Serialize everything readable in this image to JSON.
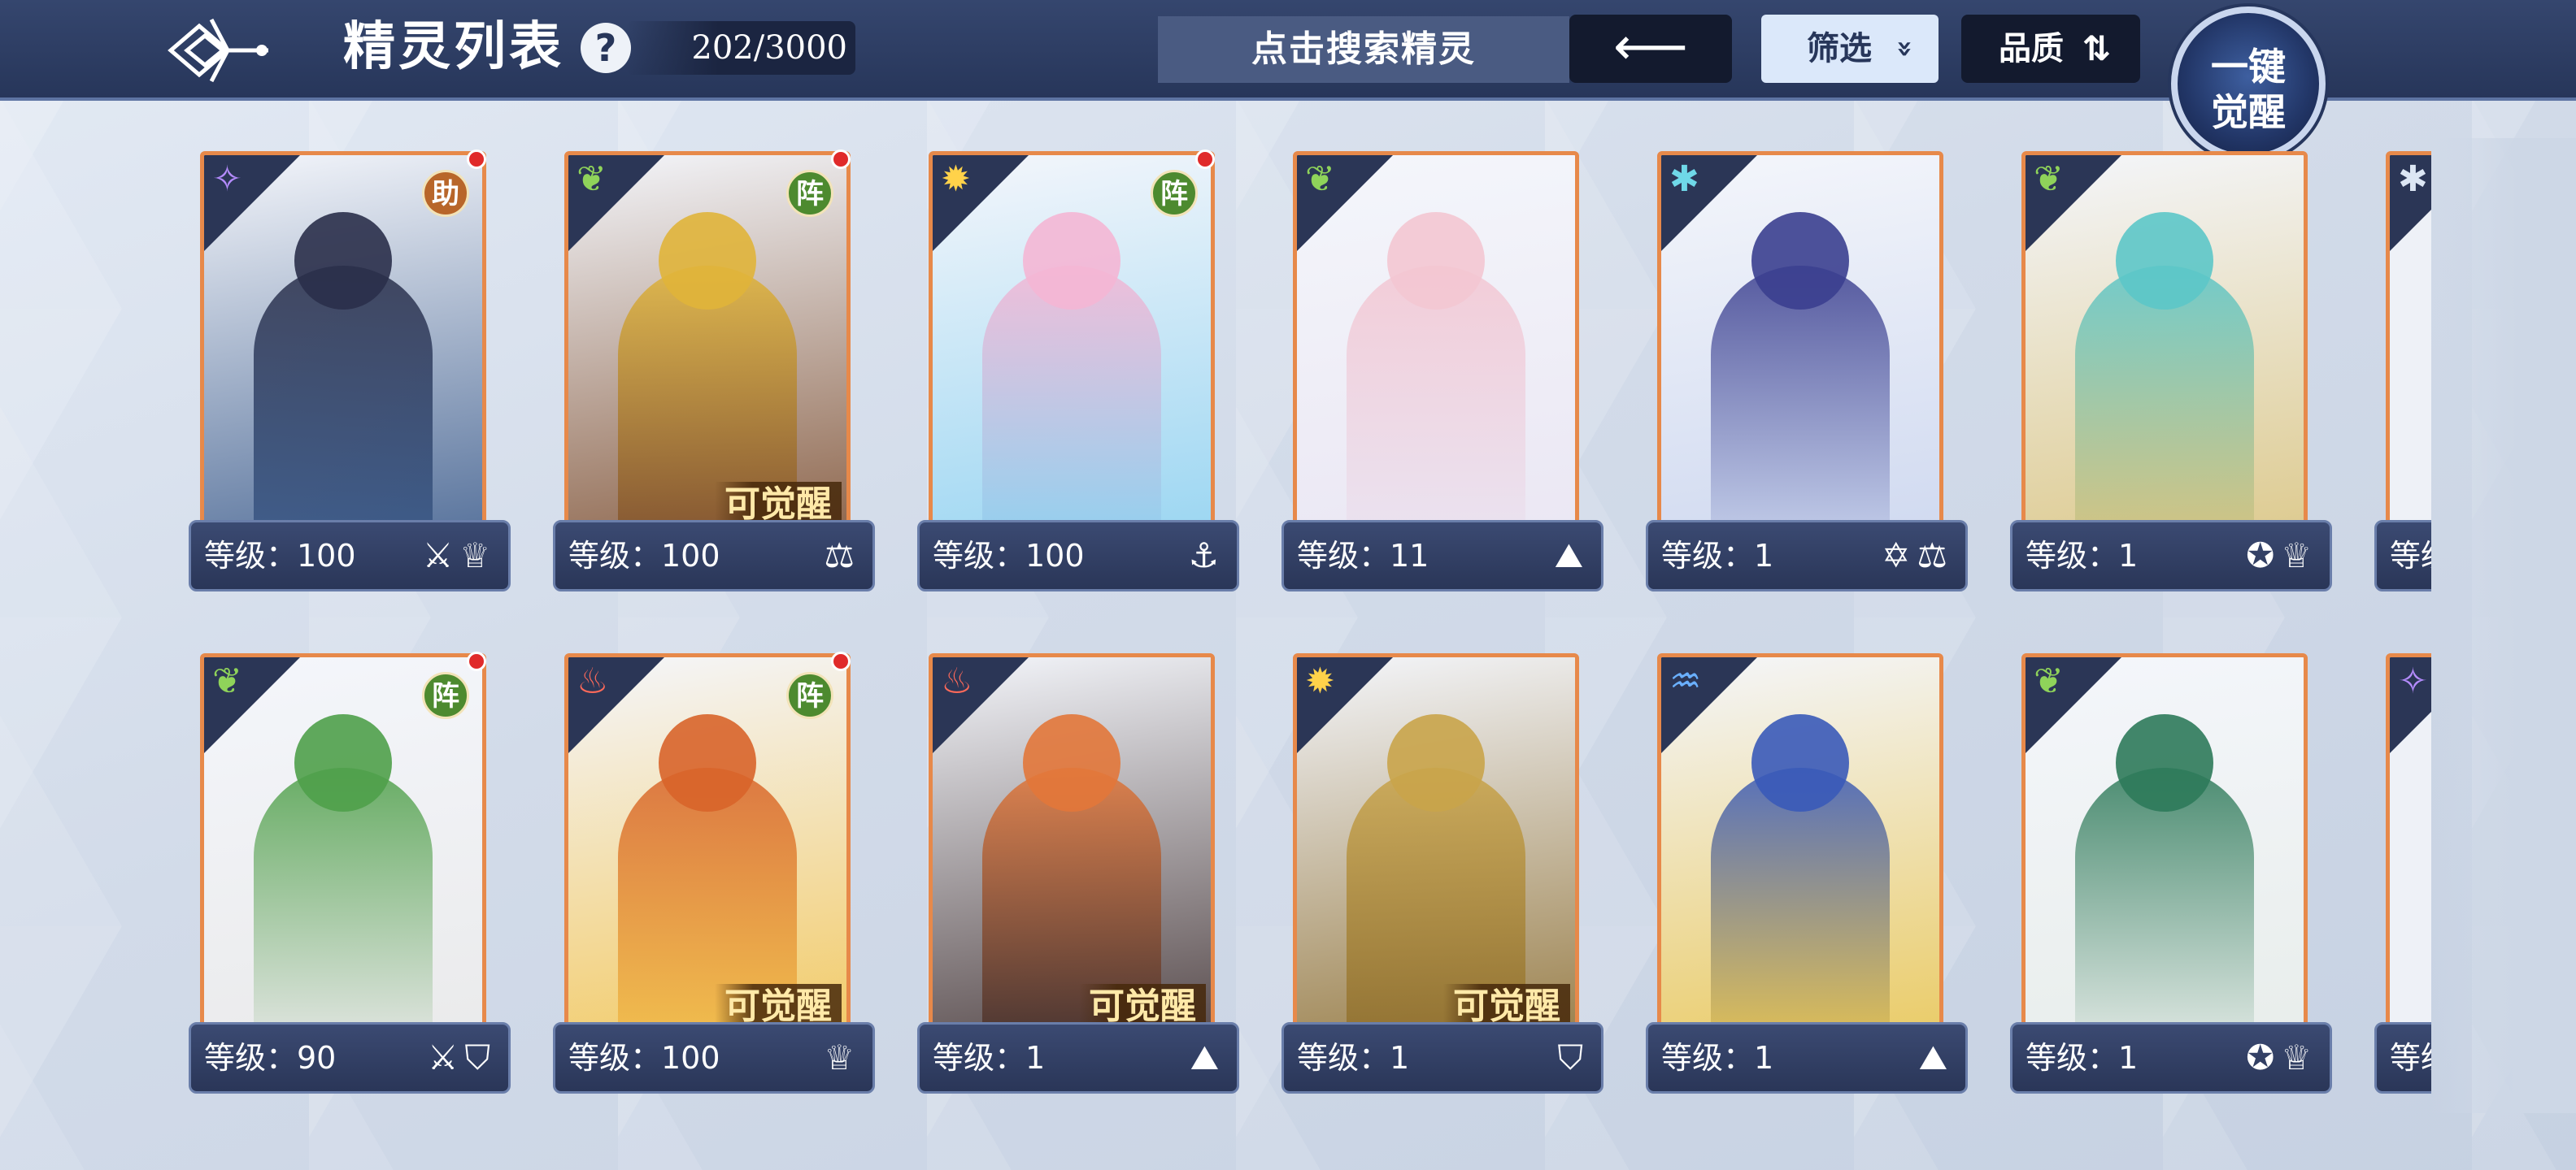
{
  "header": {
    "title": "精灵列表",
    "help_label": "?",
    "count": "202/3000",
    "search_placeholder": "点击搜索精灵",
    "back_arrow": "⟵",
    "filter_label": "筛选",
    "filter_chevron": "»",
    "sort_label": "品质",
    "sort_icon": "⇅",
    "awaken_label": "一键\n觉醒"
  },
  "colors": {
    "frame_orange": "#e7894a",
    "topbar": "#2d3c62",
    "badge_green": "#4d8a2f",
    "badge_orange": "#b8662a",
    "dot_red": "#e02a2a"
  },
  "cards": [
    {
      "element": "dark-element-icon",
      "element_symbol": "✧",
      "element_color": "#b58cff",
      "badge": "助",
      "badge_type": "zhu",
      "red_dot": true,
      "awake": "",
      "level": "等级：100",
      "icons": "⚔♕",
      "art": [
        "#2a2f4a",
        "#3a5a8a"
      ]
    },
    {
      "element": "grass-element-icon",
      "element_symbol": "❦",
      "element_color": "#8fd35a",
      "badge": "阵",
      "badge_type": "zhen",
      "red_dot": true,
      "awake": "可觉醒",
      "level": "等级：100",
      "icons": "⚖",
      "art": [
        "#e0b43a",
        "#7a4a2a"
      ]
    },
    {
      "element": "light-element-icon",
      "element_symbol": "✹",
      "element_color": "#ffd24a",
      "badge": "阵",
      "badge_type": "zhen",
      "red_dot": true,
      "awake": "",
      "level": "等级：100",
      "icons": "⚓",
      "art": [
        "#f4b6d4",
        "#8ad0f0"
      ]
    },
    {
      "element": "grass-element-icon",
      "element_symbol": "❦",
      "element_color": "#8fd35a",
      "badge": "",
      "badge_type": "",
      "red_dot": false,
      "awake": "",
      "level": "等级：11",
      "icons": "⛰",
      "art": [
        "#f3c6d2",
        "#e9e4f2"
      ]
    },
    {
      "element": "ice-element-icon",
      "element_symbol": "✱",
      "element_color": "#6fd8e8",
      "badge": "",
      "badge_type": "",
      "red_dot": false,
      "awake": "",
      "level": "等级：1",
      "icons": "✡⚖",
      "art": [
        "#3b3f8f",
        "#c9d4ee"
      ]
    },
    {
      "element": "grass-element-icon",
      "element_symbol": "❦",
      "element_color": "#8fd35a",
      "badge": "",
      "badge_type": "",
      "red_dot": false,
      "awake": "",
      "level": "等级：1",
      "icons": "✪♕",
      "art": [
        "#5cc6c8",
        "#d9c27a"
      ]
    },
    {
      "element": "grass-element-icon",
      "element_symbol": "❦",
      "element_color": "#8fd35a",
      "badge": "阵",
      "badge_type": "zhen",
      "red_dot": true,
      "awake": "",
      "level": "等级：90",
      "icons": "⚔⛉",
      "art": [
        "#4fa04a",
        "#e8e8e8"
      ]
    },
    {
      "element": "fire-element-icon",
      "element_symbol": "♨",
      "element_color": "#ff6a5a",
      "badge": "阵",
      "badge_type": "zhen",
      "red_dot": true,
      "awake": "可觉醒",
      "level": "等级：100",
      "icons": "♕",
      "art": [
        "#d8642a",
        "#f2c24a"
      ]
    },
    {
      "element": "fire-element-icon",
      "element_symbol": "♨",
      "element_color": "#ff6a5a",
      "badge": "",
      "badge_type": "",
      "red_dot": false,
      "awake": "可觉醒",
      "level": "等级：1",
      "icons": "⛰",
      "art": [
        "#e2773a",
        "#3a2a2a"
      ]
    },
    {
      "element": "light-element-icon",
      "element_symbol": "✹",
      "element_color": "#ffd24a",
      "badge": "",
      "badge_type": "",
      "red_dot": false,
      "awake": "可觉醒",
      "level": "等级：1",
      "icons": "⛉",
      "art": [
        "#c9a44a",
        "#8a6a2a"
      ]
    },
    {
      "element": "water-element-icon",
      "element_symbol": "♒",
      "element_color": "#6ab0ff",
      "badge": "",
      "badge_type": "",
      "red_dot": false,
      "awake": "",
      "level": "等级：1",
      "icons": "⛰",
      "art": [
        "#3a5ab8",
        "#e8c34a"
      ]
    },
    {
      "element": "grass-element-icon",
      "element_symbol": "❦",
      "element_color": "#8fd35a",
      "badge": "",
      "badge_type": "",
      "red_dot": false,
      "awake": "",
      "level": "等级：1",
      "icons": "✪♕",
      "art": [
        "#2e7a5a",
        "#e6ece8"
      ]
    }
  ],
  "partial_cards": [
    {
      "element": "ice-element-icon",
      "element_symbol": "✱",
      "element_color": "#dce6f4",
      "level": "等级"
    },
    {
      "element": "dark-element-icon",
      "element_symbol": "✧",
      "element_color": "#b58cff",
      "level": "等级"
    }
  ]
}
